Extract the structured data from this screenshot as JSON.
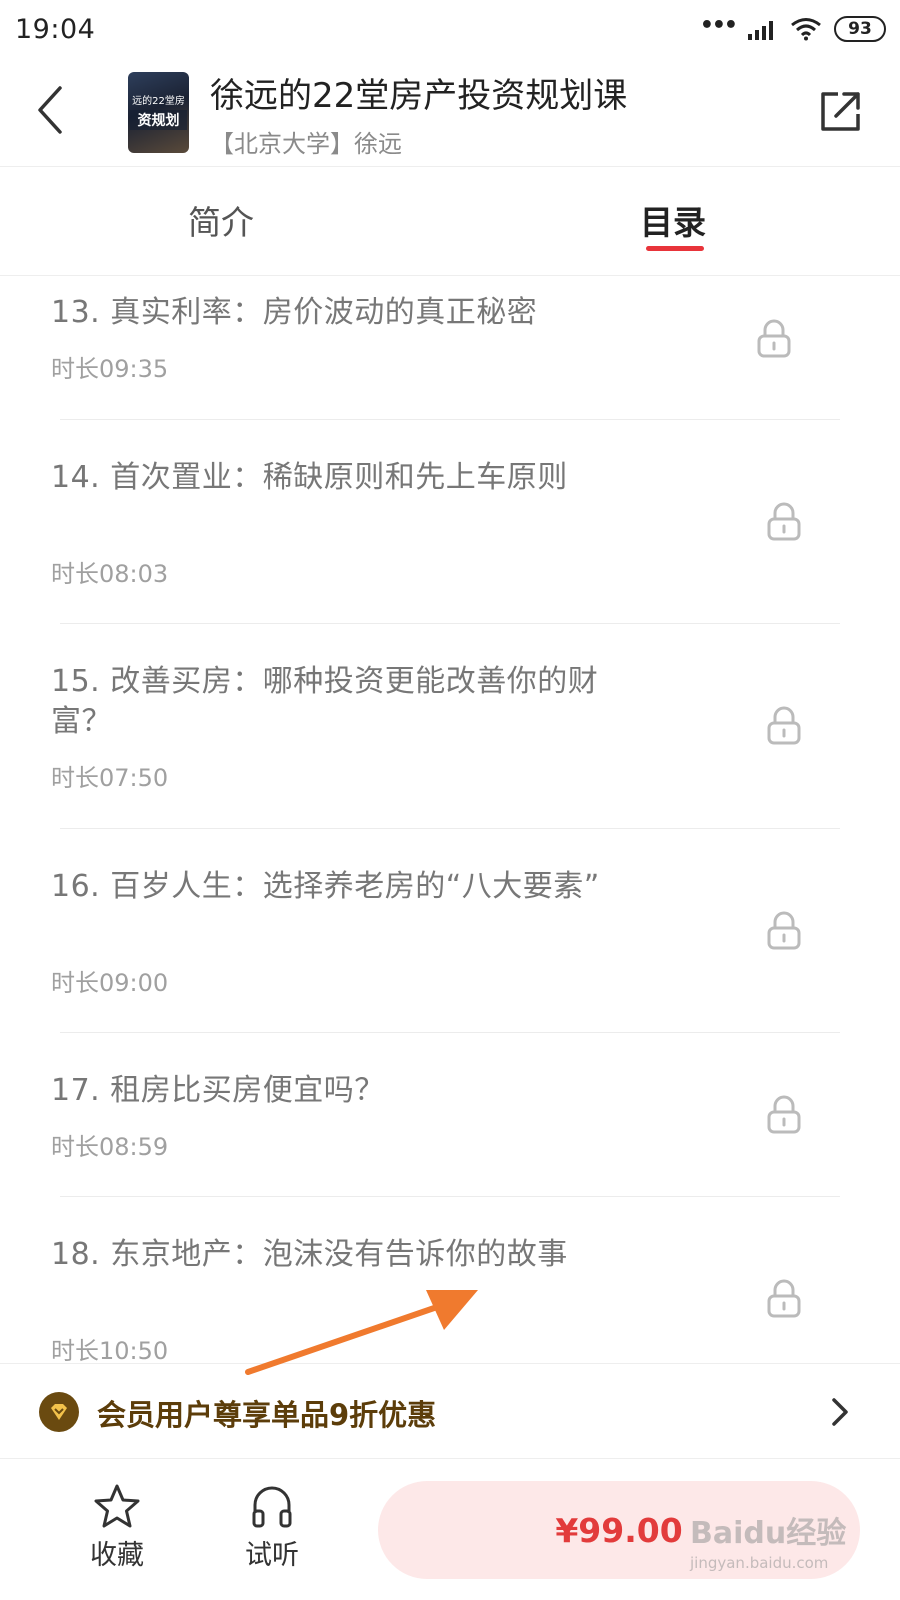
{
  "status_bar": {
    "time": "19:04",
    "signal_dots": "•••",
    "battery": "93"
  },
  "header": {
    "course_title": "徐远的22堂房产投资规划课",
    "course_subtitle": "【北京大学】徐远",
    "cover_text_top": "远的22堂房",
    "cover_text_big": "资规划",
    "back_icon": "chevron-left-icon",
    "share_icon": "share-external-icon"
  },
  "tabs": [
    {
      "label": "简介",
      "active": false
    },
    {
      "label": "目录",
      "active": true
    }
  ],
  "lessons": [
    {
      "title": "13. 真实利率：房价波动的真正秘密",
      "duration": "时长09:35",
      "locked": true
    },
    {
      "title": "14. 首次置业：稀缺原则和先上车原则",
      "duration": "时长08:03",
      "locked": true
    },
    {
      "title": "15. 改善买房：哪种投资更能改善你的财富？",
      "duration": "时长07:50",
      "locked": true
    },
    {
      "title": "16. 百岁人生：选择养老房的“八大要素”",
      "duration": "时长09:00",
      "locked": true
    },
    {
      "title": "17. 租房比买房便宜吗？",
      "duration": "时长08:59",
      "locked": true
    },
    {
      "title": "18. 东京地产：泡沫没有告诉你的故事",
      "duration": "时长10:50",
      "locked": true
    }
  ],
  "member_banner": {
    "text": "会员用户尊享单品9折优惠",
    "badge_icon": "member-diamond-icon"
  },
  "bottom_bar": {
    "favorite_label": "收藏",
    "listen_label": "试听",
    "price": "¥99.00"
  },
  "watermark": {
    "main": "Baidu经验",
    "sub": "jingyan.baidu.com"
  },
  "colors": {
    "accent": "#e8343a",
    "member_brown": "#5c3d0a",
    "buy_bg": "#fde8e8",
    "arrow": "#f07a2e"
  }
}
